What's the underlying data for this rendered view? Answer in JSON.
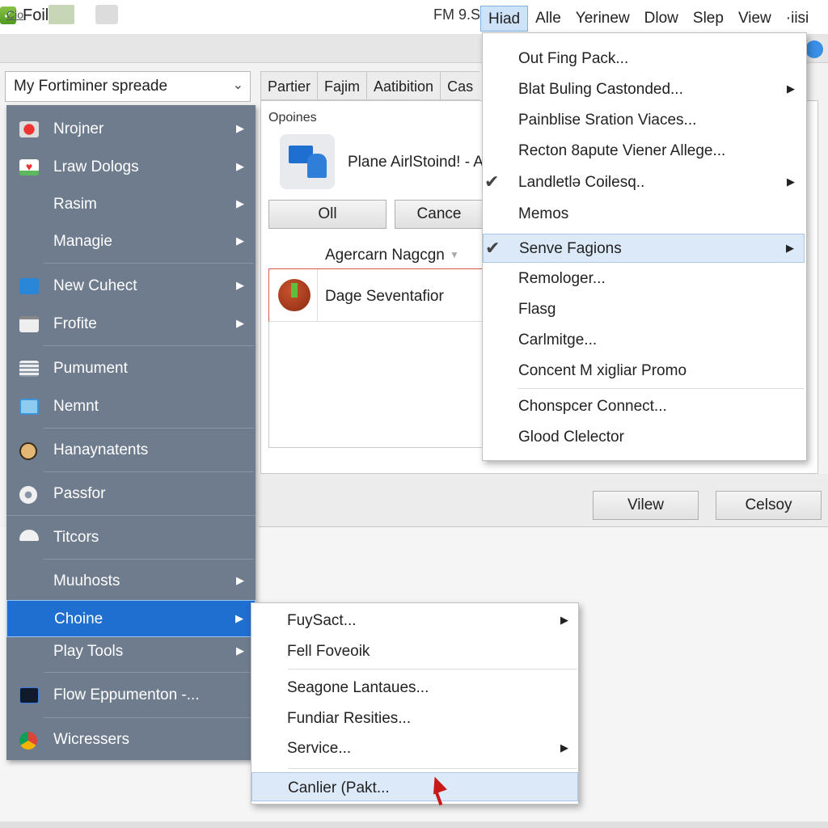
{
  "window": {
    "title": "Foile",
    "app_icon": "checkmark-shield-icon"
  },
  "menubar": [
    {
      "label": "Hiad",
      "active": true
    },
    {
      "label": "Alle"
    },
    {
      "label": "Yerinew"
    },
    {
      "label": "Dlow"
    },
    {
      "label": "Slep"
    },
    {
      "label": "View"
    },
    {
      "label": "·iisi"
    }
  ],
  "toolbar": {
    "button1_label": "Cio",
    "status": "FM 9.S"
  },
  "profile_select": {
    "value": "My Fortiminer spreade"
  },
  "tabs": [
    "Partier",
    "Fajim",
    "Aatibition",
    "Cas"
  ],
  "dialog": {
    "options_label": "Opoines",
    "app_name": "Plane AirlStoind! - A",
    "ok_label": "Oll",
    "cancel_label": "Cance",
    "list_header": "Agercarn Nagcgn",
    "list_rows": [
      {
        "label": "Dage Seventafior"
      }
    ]
  },
  "footer_buttons": {
    "view": "Vilew",
    "close": "Celsoy"
  },
  "left_menu": {
    "items": [
      {
        "label": "Nrojner",
        "icon": "record-icon",
        "submenu": true
      },
      {
        "label": "Lraw Dologs",
        "icon": "heart-icon",
        "submenu": true
      },
      {
        "label": "Rasim",
        "icon": "",
        "submenu": true
      },
      {
        "label": "Managie",
        "icon": "",
        "submenu": true
      },
      {
        "label": "New Cuhect",
        "icon": "blue-tile-icon",
        "submenu": true
      },
      {
        "label": "Frofite",
        "icon": "window-icon",
        "submenu": true
      },
      {
        "label": "Pumument",
        "icon": "stack-icon",
        "submenu": false
      },
      {
        "label": "Nemnt",
        "icon": "document-icon",
        "submenu": false
      },
      {
        "label": "Hanaynatents",
        "icon": "clock-icon",
        "submenu": false
      },
      {
        "label": "Passfor",
        "icon": "gear-icon",
        "submenu": false
      },
      {
        "label": "Titcors",
        "icon": "mushroom-icon",
        "submenu": false
      },
      {
        "label": "Muuhosts",
        "icon": "",
        "submenu": true
      },
      {
        "label": "Choine",
        "icon": "",
        "submenu": true,
        "selected": true
      },
      {
        "label": "Play Tools",
        "icon": "",
        "submenu": true
      },
      {
        "label": "Flow Eppumenton -...",
        "icon": "app-dark-icon",
        "submenu": false
      },
      {
        "label": "Wicressers",
        "icon": "chrome-icon",
        "submenu": false
      }
    ]
  },
  "hiad_menu": {
    "items": [
      {
        "label": "Out Fing Pack..."
      },
      {
        "label": "Blat Buling Castonded...",
        "submenu": true
      },
      {
        "label": "Painblise Sration Viaces..."
      },
      {
        "label": "Recton 8apute Viener Allege..."
      },
      {
        "label": "Landletlə Coilesq..",
        "checked": true,
        "submenu": true
      },
      {
        "label": "Memos"
      },
      {
        "label": "Senve Fagions",
        "checked": true,
        "submenu": true,
        "highlighted": true
      },
      {
        "label": "Remologer..."
      },
      {
        "label": "Flasg"
      },
      {
        "label": "Carlmitge..."
      },
      {
        "label": "Concent M xigliar Promo"
      },
      {
        "label": "Chonspcer Connect..."
      },
      {
        "label": "Glood Clelector"
      }
    ]
  },
  "sub_menu": {
    "items": [
      {
        "label": "FuySact...",
        "submenu": true
      },
      {
        "label": "Fell Foveoik"
      },
      {
        "label": "Seagone Lantaues..."
      },
      {
        "label": "Fundiar Resities..."
      },
      {
        "label": "Service...",
        "submenu": true
      },
      {
        "label": "Canlier (Pakt...",
        "highlighted": true
      }
    ]
  },
  "glyphs": {
    "submenu_arrow": "▶",
    "check": "✔",
    "chevron_down": "⌄",
    "sort_down": "▼",
    "app_check": "✓"
  },
  "colors": {
    "menu_panel": "#6e7c8e",
    "selected": "#1f6fd0",
    "highlight": "#dbe9f8"
  }
}
